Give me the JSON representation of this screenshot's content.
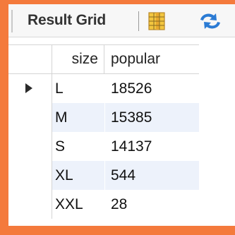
{
  "toolbar": {
    "title": "Result Grid",
    "grid_icon": "form-editor-icon",
    "refresh_icon": "refresh-icon"
  },
  "grid": {
    "columns": [
      "size",
      "popular"
    ],
    "rows": [
      {
        "size": "L",
        "popular": "18526",
        "selected": true
      },
      {
        "size": "M",
        "popular": "15385",
        "selected": false
      },
      {
        "size": "S",
        "popular": "14137",
        "selected": false
      },
      {
        "size": "XL",
        "popular": "544",
        "selected": false
      },
      {
        "size": "XXL",
        "popular": "28",
        "selected": false
      }
    ]
  },
  "colors": {
    "background": "#f47a3c",
    "alt_row": "#edf2fb",
    "refresh_blue": "#2b7bd4"
  }
}
